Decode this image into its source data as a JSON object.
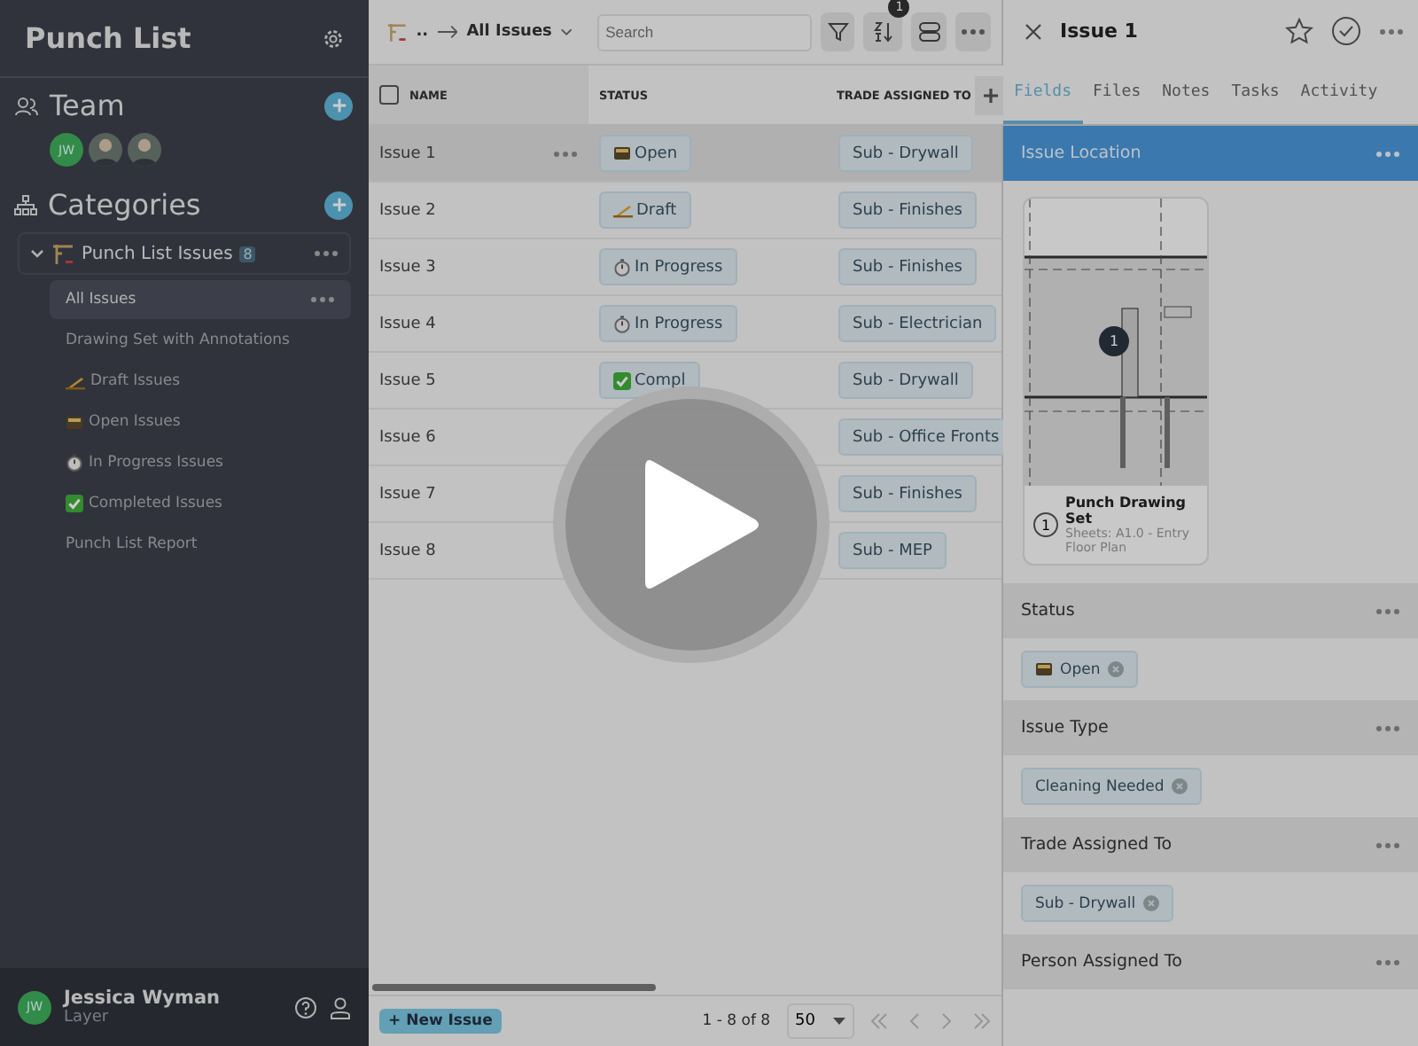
{
  "sidebar": {
    "title": "Punch List",
    "team": {
      "heading": "Team",
      "members": [
        {
          "kind": "initials",
          "initials": "JW"
        },
        {
          "kind": "photo"
        },
        {
          "kind": "photo"
        }
      ]
    },
    "categories": {
      "heading": "Categories",
      "group": {
        "label": "Punch List Issues",
        "count": "8",
        "expanded": true,
        "items": [
          {
            "kind": "plain",
            "label": "All Issues",
            "selected": true
          },
          {
            "kind": "plain",
            "label": "Drawing Set with Annotations",
            "selected": false
          },
          {
            "kind": "draft",
            "label": "Draft Issues",
            "selected": false
          },
          {
            "kind": "open",
            "label": "Open Issues",
            "selected": false
          },
          {
            "kind": "in_progress",
            "label": "In Progress Issues",
            "selected": false
          },
          {
            "kind": "completed",
            "label": "Completed Issues",
            "selected": false
          },
          {
            "kind": "plain",
            "label": "Punch List Report",
            "selected": false
          }
        ]
      }
    },
    "user": {
      "initials": "JW",
      "name": "Jessica Wyman",
      "org": "Layer"
    }
  },
  "toolbar": {
    "breadcrumb": "..",
    "view": "All Issues",
    "search": {
      "placeholder": "Search"
    },
    "sort_badge": "1"
  },
  "table": {
    "select_all": {
      "checked": false
    },
    "columns": [
      "NAME",
      "STATUS",
      "TRADE ASSIGNED TO"
    ],
    "rows": [
      {
        "name": "Issue 1",
        "selected": true,
        "status": {
          "kind": "open",
          "label": "Open"
        },
        "trade": "Sub - Drywall"
      },
      {
        "name": "Issue 2",
        "selected": false,
        "status": {
          "kind": "draft",
          "label": "Draft"
        },
        "trade": "Sub - Finishes"
      },
      {
        "name": "Issue 3",
        "selected": false,
        "status": {
          "kind": "in_progress",
          "label": "In Progress"
        },
        "trade": "Sub - Finishes"
      },
      {
        "name": "Issue 4",
        "selected": false,
        "status": {
          "kind": "in_progress",
          "label": "In Progress"
        },
        "trade": "Sub - Electrician"
      },
      {
        "name": "Issue 5",
        "selected": false,
        "status": {
          "kind": "completed",
          "label": "Compl"
        },
        "trade": "Sub - Drywall"
      },
      {
        "name": "Issue 6",
        "selected": false,
        "trade": "Sub - Office Fronts"
      },
      {
        "name": "Issue 7",
        "selected": false,
        "trade": "Sub - Finishes"
      },
      {
        "name": "Issue 8",
        "selected": false,
        "trade": "Sub - MEP"
      }
    ]
  },
  "footer": {
    "new_button": "+ New Issue",
    "range": "1 - 8 of 8",
    "page_size": "50"
  },
  "detail": {
    "title": "Issue 1",
    "tabs": [
      {
        "label": "Fields",
        "selected": true
      },
      {
        "label": "Files",
        "selected": false
      },
      {
        "label": "Notes",
        "selected": false
      },
      {
        "label": "Tasks",
        "selected": false
      },
      {
        "label": "Activity",
        "selected": false
      }
    ],
    "location": {
      "heading": "Issue Location",
      "pin": "1",
      "sheet_number": "1",
      "sheet_title": "Punch Drawing Set",
      "sheet_sub": "Sheets: A1.0 - Entry Floor Plan"
    },
    "fields": [
      {
        "label": "Status",
        "value": {
          "kind": "open",
          "label": "Open"
        }
      },
      {
        "label": "Issue Type",
        "value": {
          "kind": "plain",
          "label": "Cleaning Needed"
        }
      },
      {
        "label": "Trade Assigned To",
        "value": {
          "kind": "plain",
          "label": "Sub - Drywall"
        }
      },
      {
        "label": "Person Assigned To"
      }
    ]
  }
}
